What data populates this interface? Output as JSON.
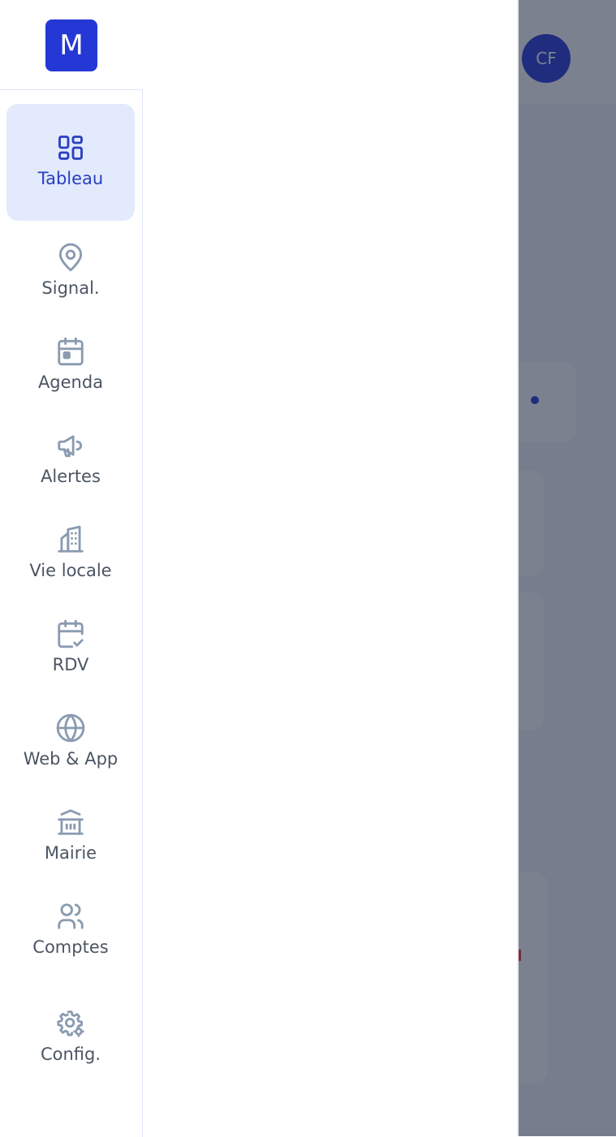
{
  "app": {
    "logo_letter": "M",
    "user_initials": "CF"
  },
  "colors": {
    "accent": "#2438d6",
    "active_bg": "#e2eafc",
    "icon_default": "#8a9bb0",
    "label_default": "#4b5563"
  },
  "sidebar": {
    "items": [
      {
        "label": "Tableau",
        "icon": "dashboard-icon",
        "active": true
      },
      {
        "label": "Signal.",
        "icon": "map-pin-icon",
        "active": false
      },
      {
        "label": "Agenda",
        "icon": "calendar-icon",
        "active": false
      },
      {
        "label": "Alertes",
        "icon": "megaphone-icon",
        "active": false
      },
      {
        "label": "Vie locale",
        "icon": "building-icon",
        "active": false
      },
      {
        "label": "RDV",
        "icon": "calendar-check-icon",
        "active": false
      },
      {
        "label": "Web & App",
        "icon": "globe-icon",
        "active": false
      },
      {
        "label": "Mairie",
        "icon": "town-hall-icon",
        "active": false
      },
      {
        "label": "Comptes",
        "icon": "users-icon",
        "active": false
      },
      {
        "label": "Config.",
        "icon": "settings-icon",
        "active": false
      }
    ]
  }
}
